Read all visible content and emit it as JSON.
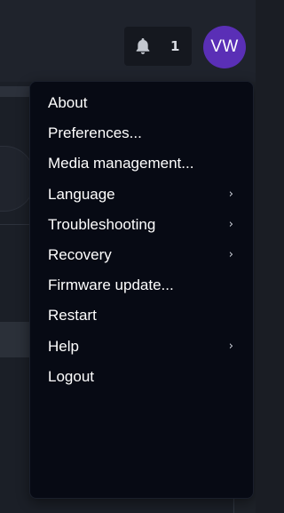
{
  "header": {
    "notifications": {
      "icon": "bell-icon",
      "count": "1"
    },
    "avatar": {
      "initials": "VW",
      "color": "#5a2fb6"
    }
  },
  "menu": {
    "items": [
      {
        "label": "About",
        "submenu": false
      },
      {
        "label": "Preferences...",
        "submenu": false
      },
      {
        "label": "Media management...",
        "submenu": false
      },
      {
        "label": "Language",
        "submenu": true,
        "chevron": "›"
      },
      {
        "label": "Troubleshooting",
        "submenu": true,
        "chevron": "›"
      },
      {
        "label": "Recovery",
        "submenu": true,
        "chevron": "›"
      },
      {
        "label": "Firmware update...",
        "submenu": false
      },
      {
        "label": "Restart",
        "submenu": false
      },
      {
        "label": "Help",
        "submenu": true,
        "chevron": "›"
      },
      {
        "label": "Logout",
        "submenu": false
      }
    ]
  }
}
